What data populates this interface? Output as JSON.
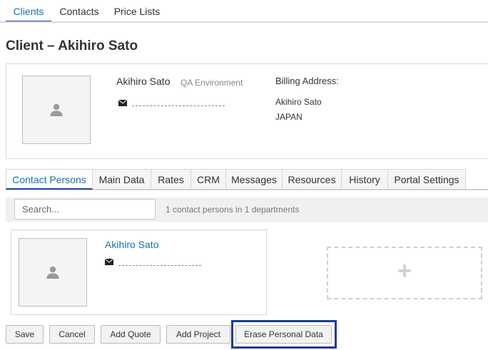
{
  "top_tabs": [
    "Clients",
    "Contacts",
    "Price Lists"
  ],
  "page_title": "Client – Akihiro Sato",
  "client": {
    "name": "Akihiro Sato",
    "environment": "QA Environment",
    "billing_label": "Billing Address:",
    "billing_name": "Akihiro Sato",
    "billing_country": "JAPAN"
  },
  "detail_tabs": [
    "Contact Persons",
    "Main Data",
    "Rates",
    "CRM",
    "Messages",
    "Resources",
    "History",
    "Portal Settings"
  ],
  "search": {
    "placeholder": "Search...",
    "count_text": "1 contact persons in 1 departments"
  },
  "contact": {
    "name": "Akihiro Sato"
  },
  "add_card": {
    "icon": "+"
  },
  "actions": [
    "Save",
    "Cancel",
    "Add Quote",
    "Add Project",
    "Erase Personal Data"
  ],
  "colors": {
    "accent": "#1a6fb5",
    "focus": "#1a3a9c"
  },
  "icons": {
    "avatar": "person-icon",
    "email": "envelope-icon",
    "add": "plus-icon"
  }
}
